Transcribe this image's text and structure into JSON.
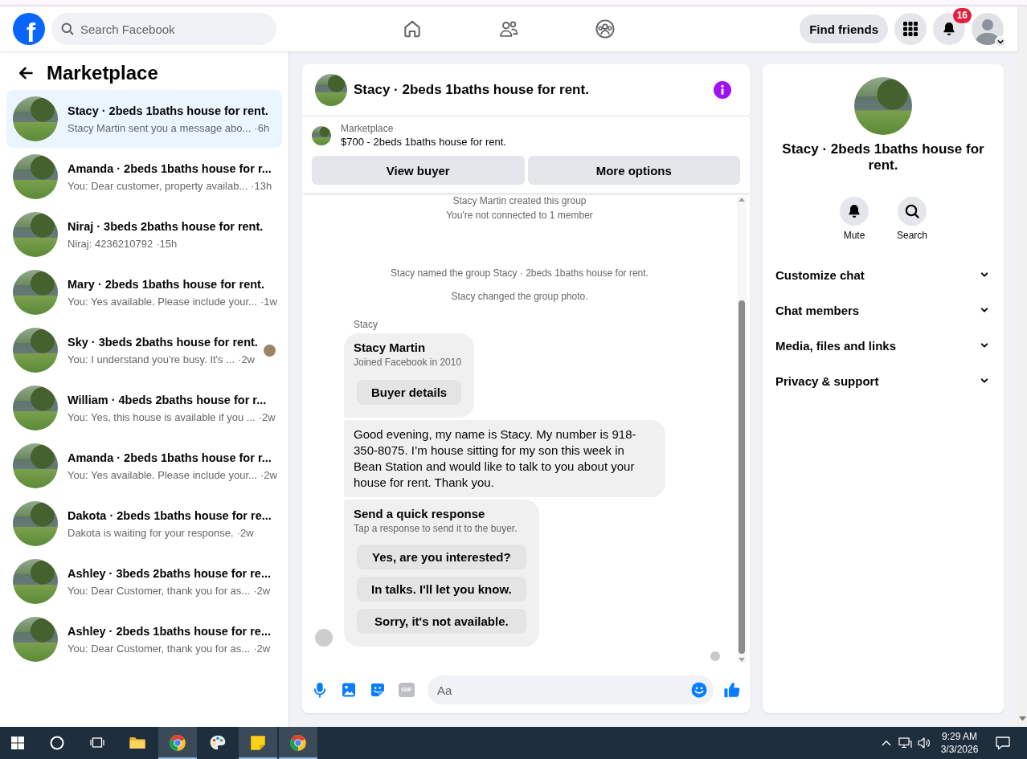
{
  "header": {
    "logo": "f",
    "search": {
      "placeholder": "Search Facebook"
    },
    "nav": [
      {
        "kind": "home",
        "selected": false
      },
      {
        "kind": "friends",
        "selected": false
      },
      {
        "kind": "groups",
        "selected": false
      }
    ],
    "find_friends": "Find friends",
    "notification_count": "16"
  },
  "sidebar": {
    "title": "Marketplace",
    "conversations": [
      {
        "title": "Stacy · 2beds 1baths house for rent.",
        "preview": "Stacy Martin sent you a message abo...",
        "time": "·6h",
        "selected": true,
        "seen": false
      },
      {
        "title": "Amanda · 2beds 1baths house for r...",
        "preview": "You: Dear customer, property availab...",
        "time": "·13h",
        "selected": false,
        "seen": false
      },
      {
        "title": "Niraj · 3beds 2baths house for rent.",
        "preview": "Niraj: 4236210792",
        "time": "·15h",
        "selected": false,
        "seen": false
      },
      {
        "title": "Mary · 2beds 1baths house for rent.",
        "preview": "You: Yes available. Please include your...",
        "time": "·1w",
        "selected": false,
        "seen": false
      },
      {
        "title": "Sky · 3beds 2baths house for rent.",
        "preview": "You: I understand you're busy. It's ...",
        "time": "·2w",
        "selected": false,
        "seen": true
      },
      {
        "title": "William · 4beds 2baths house for r...",
        "preview": "You: Yes, this house is available if you ...",
        "time": "·2w",
        "selected": false,
        "seen": false
      },
      {
        "title": "Amanda · 2beds 1baths house for r...",
        "preview": "You: Yes available. Please include your...",
        "time": "·2w",
        "selected": false,
        "seen": false
      },
      {
        "title": "Dakota · 2beds 1baths house for re...",
        "preview": "Dakota is waiting for your response.",
        "time": "·2w",
        "selected": false,
        "seen": false
      },
      {
        "title": "Ashley · 3beds 2baths house for re...",
        "preview": "You: Dear Customer, thank you for as...",
        "time": "·2w",
        "selected": false,
        "seen": false
      },
      {
        "title": "Ashley · 2beds 1baths house for re...",
        "preview": "You: Dear Customer, thank you for as...",
        "time": "·2w",
        "selected": false,
        "seen": false
      }
    ]
  },
  "chat": {
    "title": "Stacy · 2beds 1baths house for rent.",
    "listing": {
      "label": "Marketplace",
      "text": "$700 - 2beds 1baths house for rent."
    },
    "actions": [
      "View buyer",
      "More options"
    ],
    "event_groups": [
      [
        "Stacy Martin created this group",
        "You're not connected to 1 member"
      ],
      [
        "Stacy named the group Stacy · 2beds 1baths house for rent.",
        "Stacy changed the group photo."
      ]
    ],
    "sender": "Stacy",
    "messages": [
      {
        "kind": "profile",
        "title": "Stacy Martin",
        "subtitle": "Joined Facebook in 2010",
        "buttons": [
          "Buyer details"
        ]
      },
      {
        "kind": "text",
        "text": "Good evening, my name is Stacy. My number is 918-350-8075. I’m house sitting for my son this week in Bean Station and would like to talk to you about your house for rent. Thank you."
      },
      {
        "kind": "quick_replies",
        "title": "Send a quick response",
        "subtitle": "Tap a response to send it to the buyer.",
        "buttons": [
          "Yes, are you interested?",
          "In talks. I'll let you know.",
          "Sorry, it's not available."
        ]
      }
    ],
    "composer": {
      "gif": "GIF",
      "placeholder": "Aa"
    }
  },
  "details": {
    "title": "Stacy · 2beds 1baths house for rent.",
    "actions": [
      {
        "kind": "mute",
        "label": "Mute"
      },
      {
        "kind": "search",
        "label": "Search"
      }
    ],
    "sections": [
      {
        "label": "Customize chat",
        "expanded": false
      },
      {
        "label": "Chat members",
        "expanded": false
      },
      {
        "label": "Media, files and links",
        "expanded": false
      },
      {
        "label": "Privacy & support",
        "expanded": false
      }
    ]
  },
  "taskbar": {
    "apps": [
      {
        "kind": "folder",
        "open": false
      },
      {
        "kind": "browser",
        "open": true
      },
      {
        "kind": "palette",
        "open": false
      },
      {
        "kind": "notes",
        "open": true
      },
      {
        "kind": "browser",
        "open": true
      }
    ],
    "time": "9:29 AM",
    "date": "3/3/2026"
  }
}
